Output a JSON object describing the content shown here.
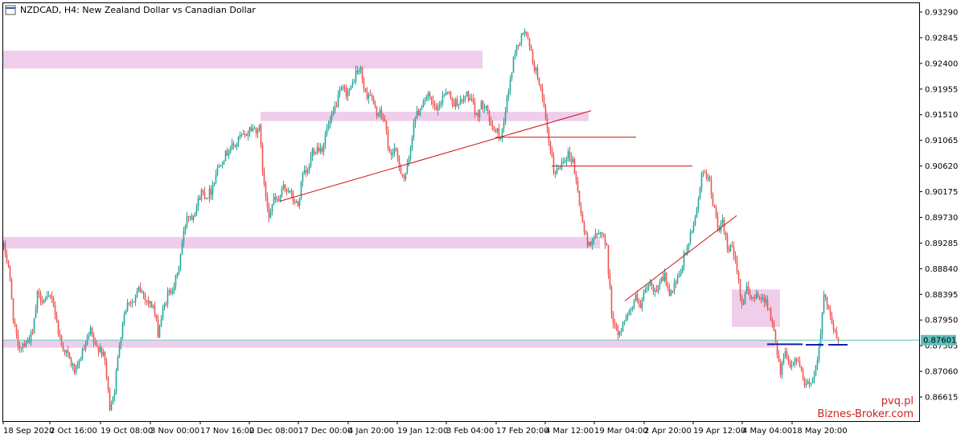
{
  "header": {
    "title": "NZDCAD, H4:  New Zealand Dollar vs Canadian Dollar"
  },
  "watermark": {
    "line1": "pvq.pl",
    "line2": "Biznes-Broker.com"
  },
  "colors": {
    "bull": "#26a69a",
    "bear": "#ef5350",
    "zone": "#efcdeb",
    "trend": "#cc1111",
    "current_line": "#5fc2bd",
    "marker": "#1a1aa8",
    "axis": "#000000"
  },
  "chart_data": {
    "type": "candlestick",
    "symbol": "NZDCAD",
    "timeframe": "H4",
    "ylim": [
      0.863,
      0.935
    ],
    "y_ticks": [
      "0.93290",
      "0.92845",
      "0.92400",
      "0.91955",
      "0.91510",
      "0.91065",
      "0.90620",
      "0.90175",
      "0.89730",
      "0.89285",
      "0.88840",
      "0.88395",
      "0.87950",
      "0.87505",
      "0.87060",
      "0.86615"
    ],
    "current_price": "0.87601",
    "x_ticks": [
      "18 Sep 2020",
      "2 Oct 16:00",
      "19 Oct 08:00",
      "3 Nov 00:00",
      "17 Nov 16:00",
      "2 Dec 08:00",
      "17 Dec 00:00",
      "4 Jan 20:00",
      "19 Jan 12:00",
      "3 Feb 04:00",
      "17 Feb 20:00",
      "4 Mar 12:00",
      "19 Mar 04:00",
      "2 Apr 20:00",
      "19 Apr 12:00",
      "4 May 04:00",
      "18 May 20:00"
    ],
    "path": [
      [
        0,
        0.8921
      ],
      [
        6,
        0.889
      ],
      [
        12,
        0.88
      ],
      [
        18,
        0.8745
      ],
      [
        24,
        0.8755
      ],
      [
        30,
        0.876
      ],
      [
        36,
        0.877
      ],
      [
        42,
        0.8838
      ],
      [
        48,
        0.8832
      ],
      [
        54,
        0.8829
      ],
      [
        60,
        0.8838
      ],
      [
        66,
        0.879
      ],
      [
        72,
        0.8752
      ],
      [
        78,
        0.8739
      ],
      [
        84,
        0.8719
      ],
      [
        90,
        0.8702
      ],
      [
        96,
        0.8732
      ],
      [
        102,
        0.875
      ],
      [
        108,
        0.8775
      ],
      [
        114,
        0.8747
      ],
      [
        120,
        0.8748
      ],
      [
        126,
        0.8723
      ],
      [
        132,
        0.8644
      ],
      [
        138,
        0.8675
      ],
      [
        144,
        0.8754
      ],
      [
        150,
        0.8808
      ],
      [
        156,
        0.883
      ],
      [
        162,
        0.8825
      ],
      [
        168,
        0.8848
      ],
      [
        174,
        0.884
      ],
      [
        180,
        0.8825
      ],
      [
        186,
        0.8819
      ],
      [
        192,
        0.8773
      ],
      [
        198,
        0.881
      ],
      [
        204,
        0.8838
      ],
      [
        210,
        0.8851
      ],
      [
        216,
        0.8872
      ],
      [
        222,
        0.8928
      ],
      [
        228,
        0.8978
      ],
      [
        234,
        0.8975
      ],
      [
        240,
        0.8993
      ],
      [
        246,
        0.9018
      ],
      [
        252,
        0.901
      ],
      [
        258,
        0.9019
      ],
      [
        264,
        0.905
      ],
      [
        270,
        0.907
      ],
      [
        276,
        0.9082
      ],
      [
        282,
        0.9094
      ],
      [
        288,
        0.9098
      ],
      [
        294,
        0.9112
      ],
      [
        300,
        0.9113
      ],
      [
        306,
        0.9127
      ],
      [
        312,
        0.9126
      ],
      [
        318,
        0.9126
      ],
      [
        324,
        0.9025
      ],
      [
        330,
        0.898
      ],
      [
        336,
        0.9003
      ],
      [
        342,
        0.9001
      ],
      [
        348,
        0.9024
      ],
      [
        354,
        0.9022
      ],
      [
        360,
        0.9003
      ],
      [
        366,
        0.8993
      ],
      [
        372,
        0.9046
      ],
      [
        378,
        0.9051
      ],
      [
        384,
        0.9089
      ],
      [
        390,
        0.9094
      ],
      [
        396,
        0.9093
      ],
      [
        402,
        0.9125
      ],
      [
        408,
        0.9144
      ],
      [
        414,
        0.9171
      ],
      [
        420,
        0.9194
      ],
      [
        426,
        0.919
      ],
      [
        432,
        0.9195
      ],
      [
        438,
        0.9224
      ],
      [
        444,
        0.9228
      ],
      [
        450,
        0.9185
      ],
      [
        456,
        0.9188
      ],
      [
        462,
        0.9157
      ],
      [
        468,
        0.9152
      ],
      [
        474,
        0.9139
      ],
      [
        480,
        0.908
      ],
      [
        486,
        0.9092
      ],
      [
        492,
        0.9062
      ],
      [
        498,
        0.9041
      ],
      [
        504,
        0.9069
      ],
      [
        510,
        0.9141
      ],
      [
        516,
        0.9156
      ],
      [
        522,
        0.9177
      ],
      [
        528,
        0.9182
      ],
      [
        534,
        0.9166
      ],
      [
        540,
        0.9158
      ],
      [
        546,
        0.9185
      ],
      [
        552,
        0.9195
      ],
      [
        558,
        0.917
      ],
      [
        564,
        0.9174
      ],
      [
        570,
        0.9171
      ],
      [
        576,
        0.9187
      ],
      [
        582,
        0.9172
      ],
      [
        588,
        0.9148
      ],
      [
        594,
        0.9167
      ],
      [
        600,
        0.9172
      ],
      [
        606,
        0.9126
      ],
      [
        612,
        0.9125
      ],
      [
        618,
        0.911
      ],
      [
        624,
        0.916
      ],
      [
        630,
        0.9211
      ],
      [
        636,
        0.9262
      ],
      [
        642,
        0.928
      ],
      [
        648,
        0.9297
      ],
      [
        654,
        0.9268
      ],
      [
        660,
        0.9233
      ],
      [
        666,
        0.921
      ],
      [
        672,
        0.9158
      ],
      [
        678,
        0.9103
      ],
      [
        684,
        0.9053
      ],
      [
        690,
        0.9056
      ],
      [
        696,
        0.9075
      ],
      [
        702,
        0.9082
      ],
      [
        708,
        0.9071
      ],
      [
        714,
        0.9016
      ],
      [
        720,
        0.8963
      ],
      [
        726,
        0.8925
      ],
      [
        732,
        0.8936
      ],
      [
        738,
        0.894
      ],
      [
        744,
        0.895
      ],
      [
        750,
        0.8918
      ],
      [
        756,
        0.8809
      ],
      [
        762,
        0.8772
      ],
      [
        768,
        0.8777
      ],
      [
        774,
        0.8806
      ],
      [
        780,
        0.8812
      ],
      [
        786,
        0.8833
      ],
      [
        792,
        0.8814
      ],
      [
        798,
        0.8846
      ],
      [
        804,
        0.8857
      ],
      [
        810,
        0.8842
      ],
      [
        816,
        0.8865
      ],
      [
        822,
        0.8872
      ],
      [
        828,
        0.8834
      ],
      [
        834,
        0.8853
      ],
      [
        840,
        0.8867
      ],
      [
        846,
        0.8904
      ],
      [
        852,
        0.893
      ],
      [
        858,
        0.8959
      ],
      [
        864,
        0.9009
      ],
      [
        870,
        0.9057
      ],
      [
        876,
        0.9045
      ],
      [
        882,
        0.9
      ],
      [
        888,
        0.8954
      ],
      [
        894,
        0.8962
      ],
      [
        900,
        0.8918
      ],
      [
        906,
        0.8916
      ],
      [
        912,
        0.8886
      ],
      [
        918,
        0.8822
      ],
      [
        924,
        0.8847
      ],
      [
        930,
        0.8829
      ],
      [
        936,
        0.8844
      ],
      [
        942,
        0.8829
      ],
      [
        948,
        0.8833
      ],
      [
        954,
        0.8797
      ],
      [
        960,
        0.8761
      ],
      [
        966,
        0.8704
      ],
      [
        972,
        0.8747
      ],
      [
        978,
        0.8713
      ],
      [
        984,
        0.8728
      ],
      [
        990,
        0.8714
      ],
      [
        996,
        0.8679
      ],
      [
        1002,
        0.8686
      ],
      [
        1008,
        0.8698
      ],
      [
        1014,
        0.8751
      ],
      [
        1020,
        0.8833
      ],
      [
        1026,
        0.882
      ],
      [
        1032,
        0.8778
      ],
      [
        1038,
        0.8756
      ]
    ],
    "zones": [
      {
        "x0": 0,
        "x1": 596,
        "y0": 0.9231,
        "y1": 0.9262
      },
      {
        "x0": 320,
        "x1": 728,
        "y0": 0.914,
        "y1": 0.9156
      },
      {
        "x0": 0,
        "x1": 742,
        "y0": 0.8919,
        "y1": 0.8939
      },
      {
        "x0": 0,
        "x1": 960,
        "y0": 0.8747,
        "y1": 0.8759
      },
      {
        "x0": 906,
        "x1": 966,
        "y0": 0.8783,
        "y1": 0.8848
      }
    ],
    "trendlines": [
      {
        "x0": 344,
        "y0": 0.9001,
        "x1": 731,
        "y1": 0.9158
      },
      {
        "x0": 612,
        "y0": 0.9112,
        "x1": 787,
        "y1": 0.9112
      },
      {
        "x0": 682,
        "y0": 0.9062,
        "x1": 857,
        "y1": 0.9062
      },
      {
        "x0": 773,
        "y0": 0.8828,
        "x1": 912,
        "y1": 0.8976
      }
    ],
    "markers": [
      {
        "x0": 950,
        "x1": 994,
        "y": 0.8753
      },
      {
        "x0": 998,
        "x1": 1020,
        "y": 0.8752
      },
      {
        "x0": 1026,
        "x1": 1050,
        "y": 0.8752
      }
    ]
  }
}
